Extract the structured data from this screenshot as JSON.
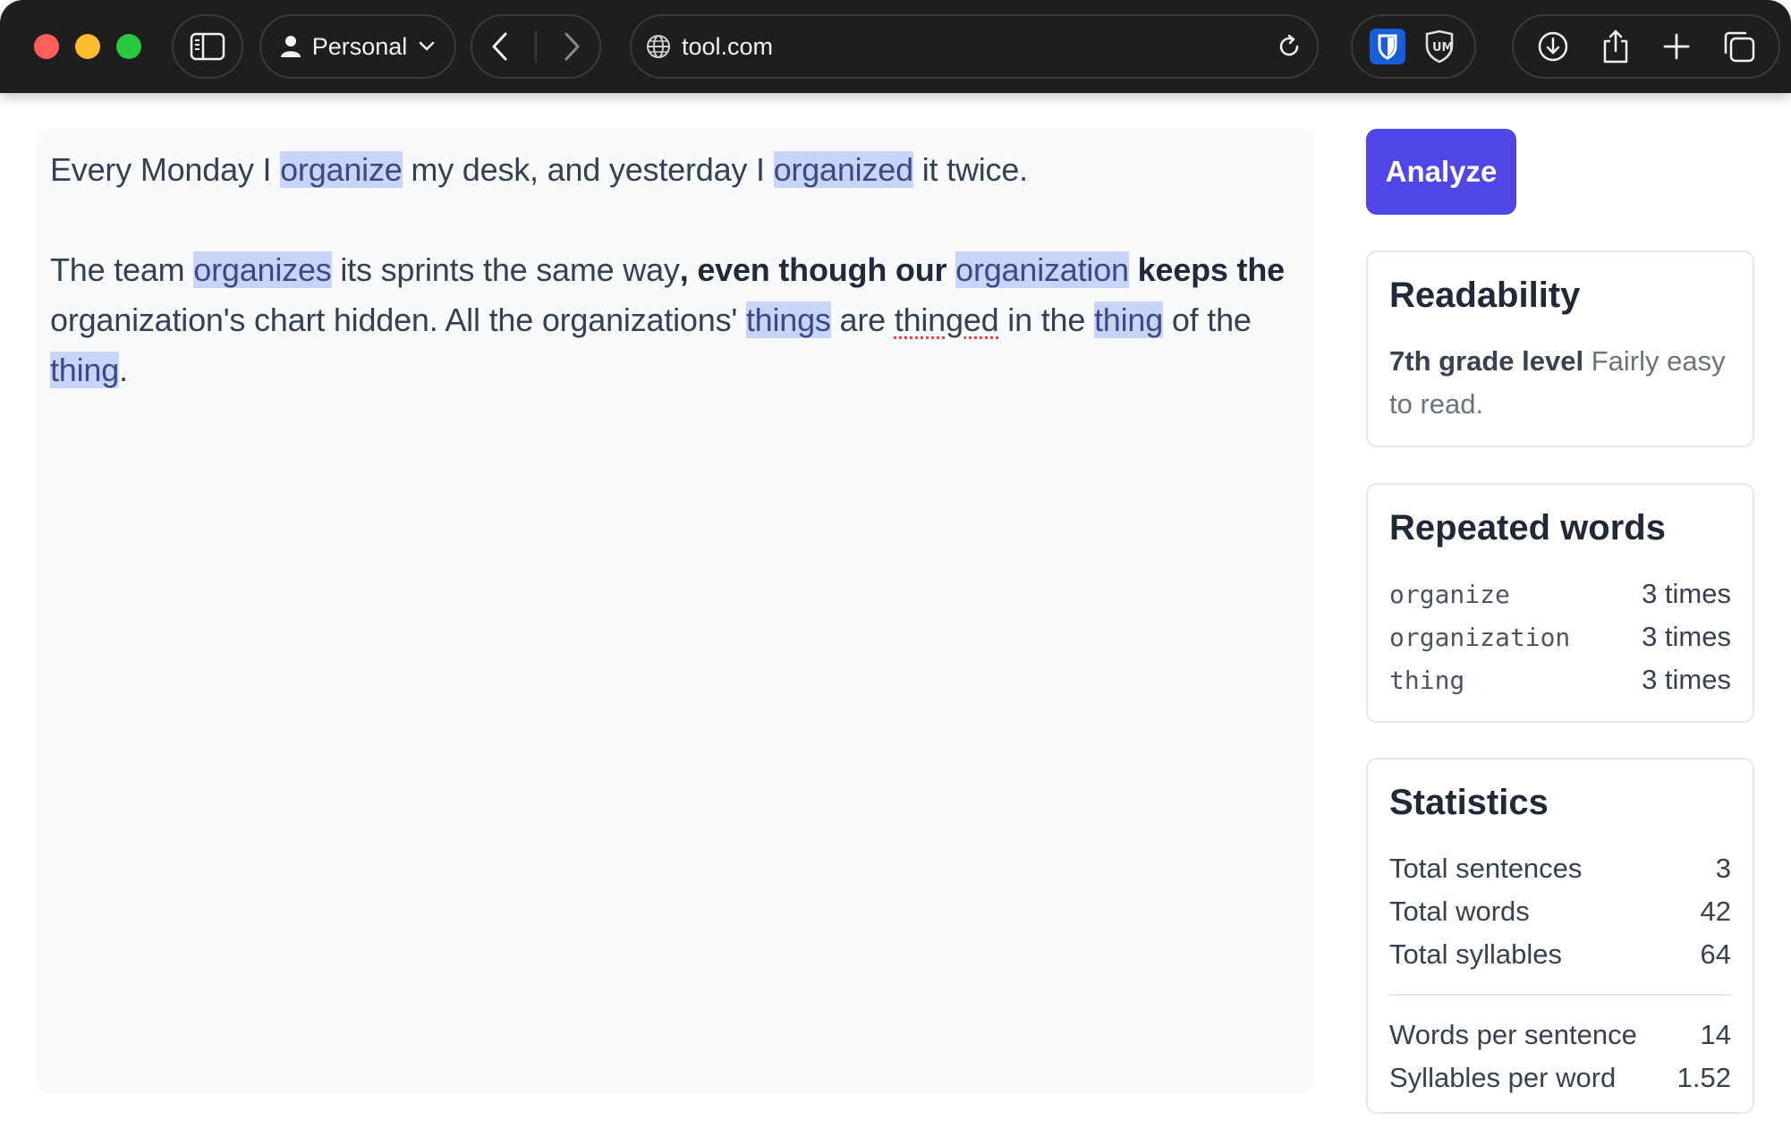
{
  "browser": {
    "profile_label": "Personal",
    "url": "tool.com"
  },
  "editor": {
    "p1": {
      "t1": "Every Monday I ",
      "h1": "organize",
      "t2": " my desk, and yesterday I ",
      "h2": "organized",
      "t3": " it twice."
    },
    "p2": {
      "t1": "The team ",
      "h1": "organizes",
      "t2": " its sprints the same way",
      "b1": ", even though our ",
      "h2": "organization",
      "b2": " keeps the",
      "t3": " organization's chart hidden. All the organizations' ",
      "h3": "things",
      "t4": " are ",
      "sq": "thinged",
      "t5": " in the ",
      "h4": "thing",
      "t6": " of the ",
      "h5": "thing",
      "t7": "."
    }
  },
  "sidebar": {
    "analyze_label": "Analyze",
    "readability": {
      "title": "Readability",
      "level": "7th grade level",
      "description": " Fairly easy to read."
    },
    "repeated": {
      "title": "Repeated words",
      "items": [
        {
          "word": "organize",
          "count": "3 times"
        },
        {
          "word": "organization",
          "count": "3 times"
        },
        {
          "word": "thing",
          "count": "3 times"
        }
      ]
    },
    "statistics": {
      "title": "Statistics",
      "rows": [
        {
          "label": "Total sentences",
          "value": "3"
        },
        {
          "label": "Total words",
          "value": "42"
        },
        {
          "label": "Total syllables",
          "value": "64"
        }
      ],
      "ratios": [
        {
          "label": "Words per sentence",
          "value": "14"
        },
        {
          "label": "Syllables per word",
          "value": "1.52"
        }
      ]
    }
  },
  "colors": {
    "accent": "#4f46e5",
    "highlight": "#c9d4fb",
    "squiggle": "#ef4444"
  }
}
